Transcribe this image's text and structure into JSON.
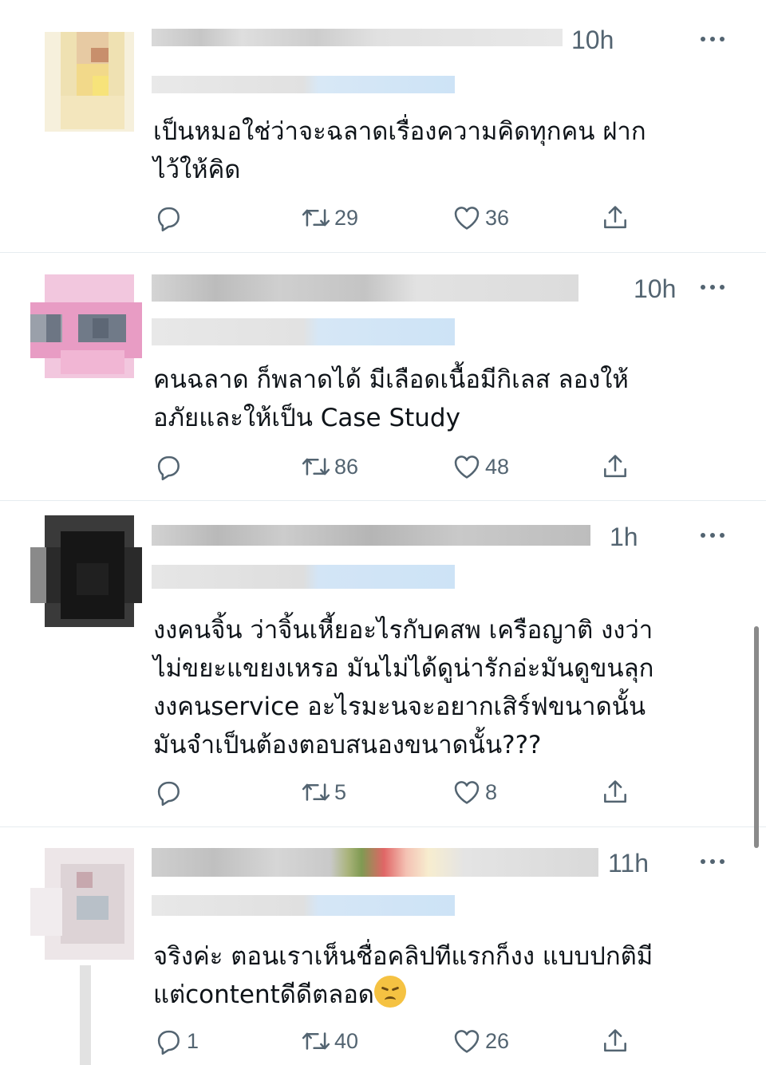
{
  "tweets": [
    {
      "time": "10h",
      "text": "เป็นหมอใช่ว่าจะฉลาดเรื่องความคิดทุกคน ฝาก\nไว้ให้คิด",
      "reply_count": "",
      "retweet_count": "29",
      "like_count": "36"
    },
    {
      "time": "10h",
      "text": "คนฉลาด ก็พลาดได้ มีเลือดเนื้อมีกิเลส ลองให้\nอภัยและให้เป็น Case Study",
      "reply_count": "",
      "retweet_count": "86",
      "like_count": "48"
    },
    {
      "time": "1h",
      "text": "งงคนจิ้น ว่าจิ้นเหี้ยอะไรกับคสพ เครือญาติ งงว่า\nไม่ขยะแขยงเหรอ มันไม่ได้ดูน่ารักอ่ะมันดูขนลุก\nงงคนservice อะไรมะนจะอยากเสิร์ฟขนาดนั้น\nมันจำเป็นต้องตอบสนองขนาดนั้น???",
      "reply_count": "",
      "retweet_count": "5",
      "like_count": "8"
    },
    {
      "time": "11h",
      "text": "จริงค่ะ ตอนเราเห็นชื่อคลิปทีแรกก็งง แบบปกติมี\nแต่contentดีดีตลอด",
      "emoji": "disappointed-face-emoji",
      "reply_count": "1",
      "retweet_count": "40",
      "like_count": "26"
    }
  ],
  "icons": {
    "reply": "reply-icon",
    "retweet": "retweet-icon",
    "like": "heart-icon",
    "share": "share-icon",
    "more": "more-options-icon"
  },
  "colors": {
    "text": "#0f1419",
    "secondary": "#536471",
    "divider": "#e6ecf0"
  }
}
